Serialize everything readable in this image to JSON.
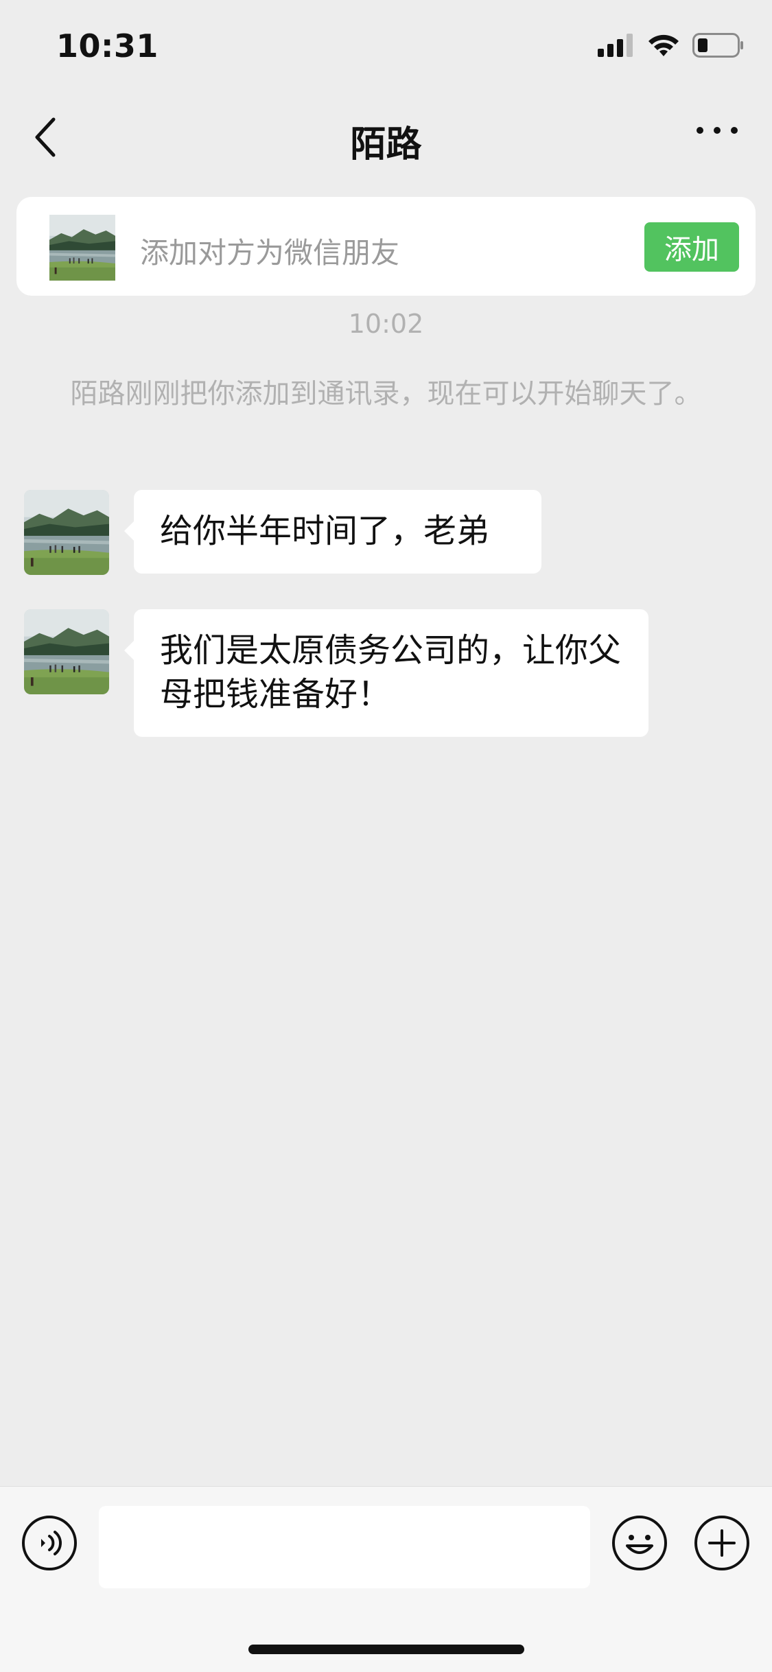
{
  "status_bar": {
    "time": "10:31"
  },
  "header": {
    "title": "陌路"
  },
  "add_friend_card": {
    "text": "添加对方为微信朋友",
    "button_label": "添加",
    "button_color": "#52c35f"
  },
  "chat": {
    "timestamp": "10:02",
    "system_message": "陌路刚刚把你添加到通讯录，现在可以开始聊天了。",
    "messages": [
      {
        "text": "给你半年时间了，老弟"
      },
      {
        "text": "我们是太原债务公司的，让你父母把钱准备好！"
      }
    ]
  },
  "input_bar": {
    "placeholder": "",
    "icons": [
      "voice-icon",
      "emoji-icon",
      "plus-icon"
    ]
  },
  "colors": {
    "background": "#ededed",
    "bubble": "#ffffff",
    "accent_green": "#52c35f",
    "muted_text": "#b1b1b1"
  }
}
